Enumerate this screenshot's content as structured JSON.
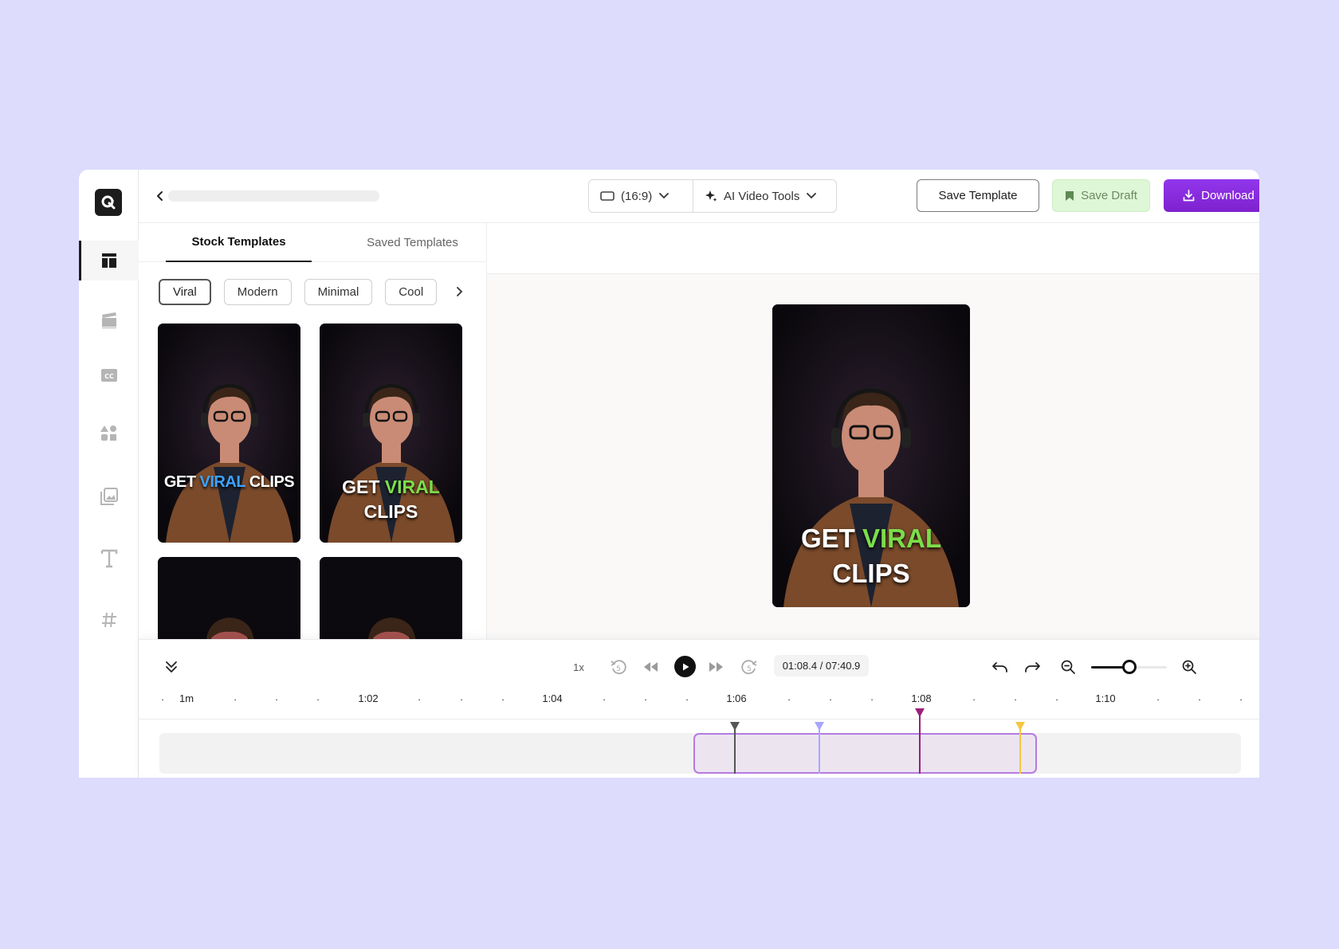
{
  "topbar": {
    "aspect_ratio": "(16:9)",
    "ai_tools_label": "AI Video Tools",
    "save_template_label": "Save Template",
    "save_draft_label": "Save Draft",
    "download_label": "Download"
  },
  "panel": {
    "tabs": [
      {
        "label": "Stock Templates",
        "active": true
      },
      {
        "label": "Saved Templates",
        "active": false
      }
    ],
    "chips": [
      "Viral",
      "Modern",
      "Minimal",
      "Cool"
    ],
    "templates": [
      {
        "line1_white": "GET",
        "line1_accent": "VIRAL",
        "line1_tail": "CLIPS",
        "accent": "#3ea2ff"
      },
      {
        "line1_white": "GET",
        "line1_accent": "VIRAL",
        "line2": "CLIPS",
        "accent": "#7bde4b"
      }
    ]
  },
  "preview": {
    "caption_white": "GET",
    "caption_accent": "VIRAL",
    "caption_line2": "CLIPS",
    "accent": "#7bde4b"
  },
  "timeline": {
    "speed": "1x",
    "timecode": "01:08.4 / 07:40.9",
    "zoom_level": 0.5,
    "ruler_labels": [
      "1m",
      "1:02",
      "1:04",
      "1:06",
      "1:08",
      "1:10"
    ]
  },
  "colors": {
    "accent_purple": "#8a2be2",
    "marker_dark": "#555555",
    "marker_lavender": "#a9a6ff",
    "marker_magenta": "#9c1f7a",
    "marker_yellow": "#f6c642"
  }
}
